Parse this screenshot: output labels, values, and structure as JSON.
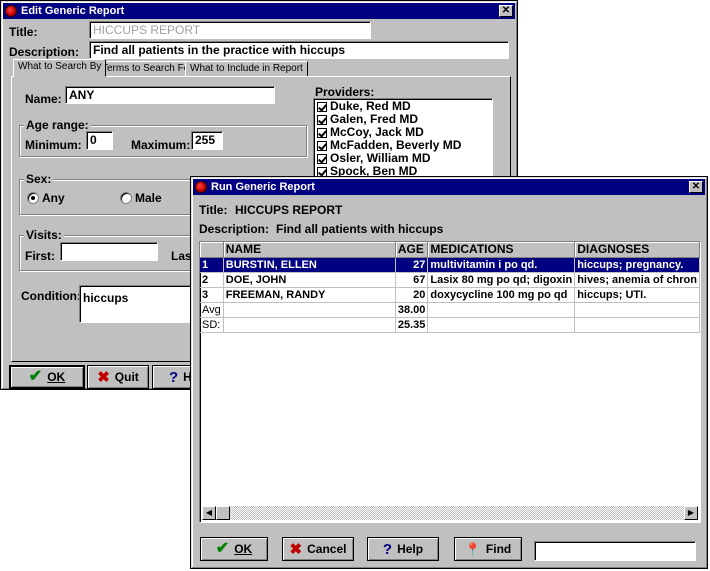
{
  "edit_window": {
    "title": "Edit Generic Report",
    "title_label": "Title:",
    "title_value": "HICCUPS REPORT",
    "description_label": "Description:",
    "description_value": "Find all patients in the practice with hiccups",
    "tabs": [
      {
        "label": "What to Search By",
        "active": true
      },
      {
        "label": "Terms to Search For",
        "active": false
      },
      {
        "label": "What to Include in Report",
        "active": false
      }
    ],
    "name_label": "Name:",
    "name_value": "ANY",
    "age_range": {
      "title": "Age range:",
      "min_label": "Minimum:",
      "min_value": "0",
      "max_label": "Maximum:",
      "max_value": "255"
    },
    "sex": {
      "title": "Sex:",
      "options": [
        {
          "label": "Any",
          "selected": true
        },
        {
          "label": "Male",
          "selected": false
        }
      ]
    },
    "visits": {
      "title": "Visits:",
      "first_label": "First:",
      "first_value": "",
      "last_label": "Las"
    },
    "condition_label": "Condition:",
    "condition_value": "hiccups",
    "providers": {
      "title": "Providers:",
      "items": [
        {
          "label": "Duke, Red MD",
          "checked": true
        },
        {
          "label": "Galen, Fred MD",
          "checked": true
        },
        {
          "label": "McCoy, Jack MD",
          "checked": true
        },
        {
          "label": "McFadden, Beverly MD",
          "checked": true
        },
        {
          "label": "Osler, William MD",
          "checked": true
        },
        {
          "label": "Spock, Ben MD",
          "checked": true
        }
      ]
    },
    "buttons": {
      "ok": "OK",
      "quit": "Quit",
      "help": "H"
    }
  },
  "run_window": {
    "title": "Run Generic Report",
    "title_label": "Title:",
    "title_value": "HICCUPS REPORT",
    "description_label": "Description:",
    "description_value": "Find all patients with hiccups",
    "columns": [
      "",
      "NAME",
      "AGE",
      "MEDICATIONS",
      "DIAGNOSES"
    ],
    "rows": [
      {
        "num": "1",
        "name": "BURSTIN, ELLEN",
        "age": "27",
        "meds": "multivitamin i po qd.",
        "dx": "hiccups; pregnancy.",
        "selected": true
      },
      {
        "num": "2",
        "name": "DOE, JOHN",
        "age": "67",
        "meds": "Lasix 80 mg po qd; digoxin",
        "dx": "hives; anemia of chron",
        "selected": false
      },
      {
        "num": "3",
        "name": "FREEMAN, RANDY",
        "age": "20",
        "meds": "doxycycline 100 mg po qd",
        "dx": "hiccups; UTI.",
        "selected": false
      }
    ],
    "stats": [
      {
        "label": "Avg",
        "age": "38.00"
      },
      {
        "label": "SD:",
        "age": "25.35"
      }
    ],
    "buttons": {
      "ok": "OK",
      "cancel": "Cancel",
      "help": "Help",
      "find": "Find"
    },
    "find_value": ""
  },
  "colors": {
    "titlebar": "#000080",
    "face": "#c0c0c0",
    "selection": "#000080"
  }
}
